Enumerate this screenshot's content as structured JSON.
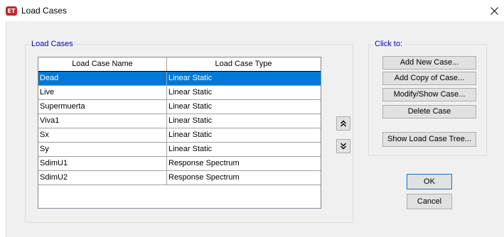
{
  "window": {
    "app_icon_text": "ET",
    "title": "Load Cases",
    "close_glyph": "×"
  },
  "load_cases_group": {
    "label": "Load Cases",
    "table": {
      "columns": [
        "Load Case Name",
        "Load Case Type"
      ],
      "rows": [
        {
          "name": "Dead",
          "type": "Linear Static",
          "selected": true
        },
        {
          "name": "Live",
          "type": "Linear Static"
        },
        {
          "name": "Supermuerta",
          "type": "Linear Static"
        },
        {
          "name": "Viva1",
          "type": "Linear Static"
        },
        {
          "name": "Sx",
          "type": "Linear Static"
        },
        {
          "name": "Sy",
          "type": "Linear Static"
        },
        {
          "name": "SdimU1",
          "type": "Response Spectrum"
        },
        {
          "name": "SdimU2",
          "type": "Response Spectrum"
        }
      ]
    },
    "move_up_icon": "double-chevron-up-icon",
    "move_down_icon": "double-chevron-down-icon"
  },
  "click_to_group": {
    "label": "Click to:",
    "buttons": {
      "add_new": "Add New Case...",
      "add_copy": "Add Copy of Case...",
      "modify_show": "Modify/Show Case...",
      "delete": "Delete Case",
      "show_tree": "Show Load Case Tree..."
    }
  },
  "dialog_buttons": {
    "ok": "OK",
    "cancel": "Cancel"
  },
  "colors": {
    "selection": "#0078d7",
    "group_label": "#0000c8",
    "app_icon": "#c4262e"
  }
}
